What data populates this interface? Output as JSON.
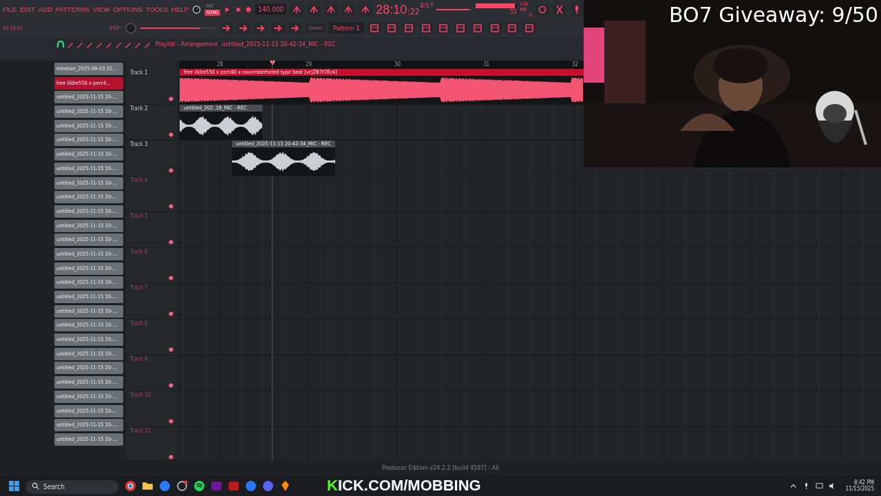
{
  "toolbar": {
    "menu": [
      "FILE",
      "EDIT",
      "ADD",
      "PATTERNS",
      "VIEW",
      "OPTIONS",
      "TOOLS",
      "HELP"
    ],
    "modes": [
      {
        "label": "PAT",
        "selected": false
      },
      {
        "label": "SONG",
        "selected": true
      }
    ],
    "tempo": "140.000",
    "song_time": "28:10",
    "song_time_ticks": ":22",
    "time_format": "B:S:T",
    "position": {
      "level": 0.92
    },
    "cpu": {
      "reading": "55",
      "level": 0.95
    },
    "memory": "530 MB",
    "polyphony": "0",
    "elapsed": "31:13:17",
    "hint_time": "0'53''",
    "master_volume": {
      "level": 0.78
    },
    "channel_target": "(none)",
    "pattern": "Pattern 1"
  },
  "playlist": {
    "breadcrumb": [
      "Playlist - Arrangement",
      "untitled_2025-11-15 20-42-34_MIC - REC"
    ],
    "browser_items": [
      {
        "label": "mention_2025-09-03 22...",
        "selected": false
      },
      {
        "label": "free lildre556 x perc4...",
        "selected": true
      },
      {
        "label": "untitled_2025-11-15 20-...",
        "selected": false
      },
      {
        "label": "untitled_2025-11-15 20-...",
        "selected": false
      },
      {
        "label": "untitled_2025-11-15 20-...",
        "selected": false
      },
      {
        "label": "untitled_2025-11-15 20-...",
        "selected": false
      },
      {
        "label": "untitled_2025-11-15 20-...",
        "selected": false
      },
      {
        "label": "untitled_2025-11-15 20-...",
        "selected": false
      },
      {
        "label": "untitled_2025-11-15 20-...",
        "selected": false
      },
      {
        "label": "untitled_2025-11-15 20-...",
        "selected": false
      },
      {
        "label": "untitled_2025-11-15 20-...",
        "selected": false
      },
      {
        "label": "untitled_2025-11-15 20-...",
        "selected": false
      },
      {
        "label": "untitled_2025-11-15 20-...",
        "selected": false
      },
      {
        "label": "untitled_2025-11-15 20-...",
        "selected": false
      },
      {
        "label": "untitled_2025-11-15 20-...",
        "selected": false
      },
      {
        "label": "untitled_2025-11-15 20-...",
        "selected": false
      },
      {
        "label": "untitled_2025-11-15 20-...",
        "selected": false
      },
      {
        "label": "untitled_2025-11-15 20-...",
        "selected": false
      },
      {
        "label": "untitled_2025-11-15 20-...",
        "selected": false
      },
      {
        "label": "untitled_2025-11-15 20-...",
        "selected": false
      },
      {
        "label": "untitled_2025-11-15 20-...",
        "selected": false
      },
      {
        "label": "untitled_2025-11-15 20-...",
        "selected": false
      },
      {
        "label": "untitled_2025-11-15 20-...",
        "selected": false
      },
      {
        "label": "untitled_2025-11-15 20-...",
        "selected": false
      },
      {
        "label": "untitled_2025-11-15 20-...",
        "selected": false
      },
      {
        "label": "untitled_2025-11-15 20-...",
        "selected": false
      },
      {
        "label": "untitled_2025-11-15 20-...",
        "selected": false
      }
    ],
    "ruler": [
      "28",
      "29",
      "30",
      "31",
      "32"
    ],
    "tracks": [
      {
        "name": "Track 1",
        "used": true,
        "on": true,
        "clips": [
          {
            "title": "free lildre556 x perc40 x novemberhated type beat [vcjZB7t7Ez4]",
            "color": "#c8102e"
          }
        ]
      },
      {
        "name": "Track 2",
        "used": true,
        "on": true,
        "clips": [
          {
            "title": "untitled_202..18_MIC - REC",
            "color": "#4a4f55"
          }
        ]
      },
      {
        "name": "Track 3",
        "used": true,
        "on": true,
        "clips": [
          {
            "title": "untitled_2025-11-15 20-42-34_MIC - REC",
            "color": "#4a4f55"
          }
        ]
      },
      {
        "name": "Track 4",
        "used": false,
        "on": true
      },
      {
        "name": "Track 5",
        "used": false,
        "on": true
      },
      {
        "name": "Track 6",
        "used": false,
        "on": true
      },
      {
        "name": "Track 7",
        "used": false,
        "on": true
      },
      {
        "name": "Track 8",
        "used": false,
        "on": true
      },
      {
        "name": "Track 9",
        "used": false,
        "on": true
      },
      {
        "name": "Track 10",
        "used": false,
        "on": true
      },
      {
        "name": "Track 11",
        "used": false,
        "on": true
      }
    ]
  },
  "status_text": "Producer Edition v24.2.2 [build 4597] - All",
  "overlay": {
    "giveaway": "BO7 Giveaway: 9/50",
    "channel": "KICK.COM/MOBBING"
  },
  "taskbar": {
    "search_placeholder": "Search",
    "time": "8:42 PM",
    "date": "11/15/2025"
  }
}
